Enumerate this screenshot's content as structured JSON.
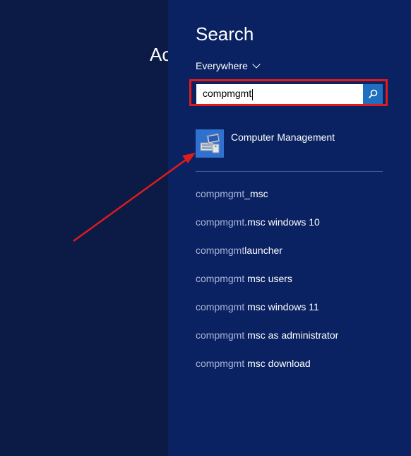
{
  "background": {
    "partial_text": "Ac"
  },
  "search_pane": {
    "title": "Search",
    "scope": "Everywhere",
    "query": "compmgmt",
    "top_result": {
      "label": "Computer Management",
      "icon": "computer-management-icon"
    },
    "suggestions": [
      {
        "query": "compmgmt",
        "rest": "_msc"
      },
      {
        "query": "compmgmt",
        "rest": ".msc windows 10"
      },
      {
        "query": "compmgmt",
        "rest": "launcher"
      },
      {
        "query": "compmgmt",
        "rest": " msc users"
      },
      {
        "query": "compmgmt",
        "rest": " msc windows 11"
      },
      {
        "query": "compmgmt",
        "rest": " msc as administrator"
      },
      {
        "query": "compmgmt",
        "rest": " msc download"
      }
    ]
  },
  "colors": {
    "pane_bg": "#0b2262",
    "left_bg": "#0b1b46",
    "accent": "#1e6fc0",
    "annotation": "#e01b1b"
  }
}
